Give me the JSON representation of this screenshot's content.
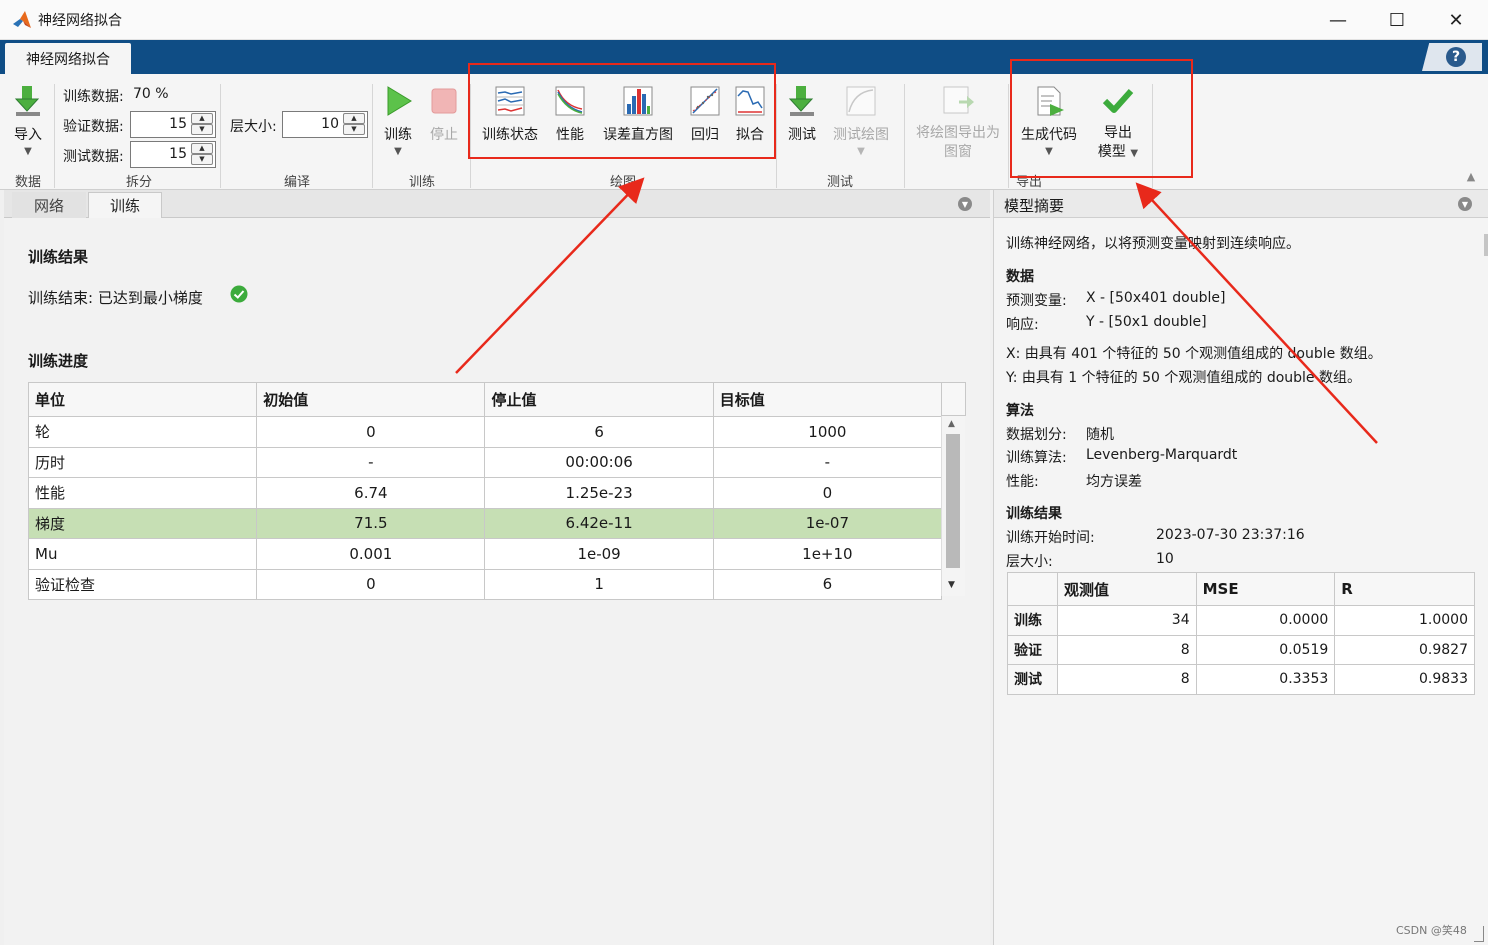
{
  "window": {
    "title": "神经网络拟合",
    "minimize": "—",
    "maximize": "☐",
    "close": "✕"
  },
  "ribbon_tab": "神经网络拟合",
  "help": "?",
  "ribbon": {
    "data_group": {
      "label": "数据",
      "import": "导入"
    },
    "split_group": {
      "label": "拆分",
      "train_label": "训练数据:",
      "train_value": "70 %",
      "validation_label": "验证数据:",
      "validation_value": "15",
      "test_label": "测试数据:",
      "test_value": "15"
    },
    "compile_group": {
      "label": "编译",
      "layer_label": "层大小:",
      "layer_value": "10"
    },
    "train_group": {
      "label": "训练",
      "train": "训练",
      "stop": "停止"
    },
    "plot_group": {
      "label": "绘图",
      "training_state": "训练状态",
      "performance": "性能",
      "error_histogram": "误差直方图",
      "regression": "回归",
      "fit": "拟合"
    },
    "test_group": {
      "label": "测试",
      "test": "测试",
      "test_plot": "测试绘图"
    },
    "export_plot": {
      "line1": "将绘图导出为",
      "line2": "图窗"
    },
    "export_group": {
      "label": "导出",
      "generate_code": "生成代码",
      "export_model_line1": "导出",
      "export_model_line2": "模型"
    }
  },
  "left_panel": {
    "tabs": [
      "网络",
      "训练"
    ],
    "results_title": "训练结果",
    "results_text": "训练结束: 已达到最小梯度",
    "progress_title": "训练进度",
    "progress_table": {
      "headers": [
        "单位",
        "初始值",
        "停止值",
        "目标值"
      ],
      "rows": [
        [
          "轮",
          "0",
          "6",
          "1000"
        ],
        [
          "历时",
          "-",
          "00:00:06",
          "-"
        ],
        [
          "性能",
          "6.74",
          "1.25e-23",
          "0"
        ],
        [
          "梯度",
          "71.5",
          "6.42e-11",
          "1e-07"
        ],
        [
          "Mu",
          "0.001",
          "1e-09",
          "1e+10"
        ],
        [
          "验证检查",
          "0",
          "1",
          "6"
        ]
      ]
    }
  },
  "right_panel": {
    "title": "模型摘要",
    "intro": "训练神经网络，以将预测变量映射到连续响应。",
    "data_title": "数据",
    "predictor_label": "预测变量:",
    "predictor_value": "X - [50x401 double]",
    "response_label": "响应:",
    "response_value": "Y - [50x1 double]",
    "x_desc": "X: 由具有 401 个特征的 50 个观测值组成的 double 数组。",
    "y_desc": "Y: 由具有 1 个特征的 50 个观测值组成的 double 数组。",
    "algo_title": "算法",
    "division_label": "数据划分:",
    "division_value": "随机",
    "training_algo_label": "训练算法:",
    "training_algo_value": "Levenberg-Marquardt",
    "performance_label": "性能:",
    "performance_value": "均方误差",
    "results_title": "训练结果",
    "start_time_label": "训练开始时间:",
    "start_time_value": "2023-07-30 23:37:16",
    "layer_label": "层大小:",
    "layer_value": "10",
    "summary_table": {
      "headers": [
        "",
        "观测值",
        "MSE",
        "R"
      ],
      "rows": [
        [
          "训练",
          "34",
          "0.0000",
          "1.0000"
        ],
        [
          "验证",
          "8",
          "0.0519",
          "0.9827"
        ],
        [
          "测试",
          "8",
          "0.3353",
          "0.9833"
        ]
      ]
    }
  },
  "watermark": "CSDN @笑48",
  "colors": {
    "accent": "#0f4d85",
    "highlight_row": "#c6dfb4",
    "annotation": "#e8291b",
    "success": "#3cab3c"
  }
}
